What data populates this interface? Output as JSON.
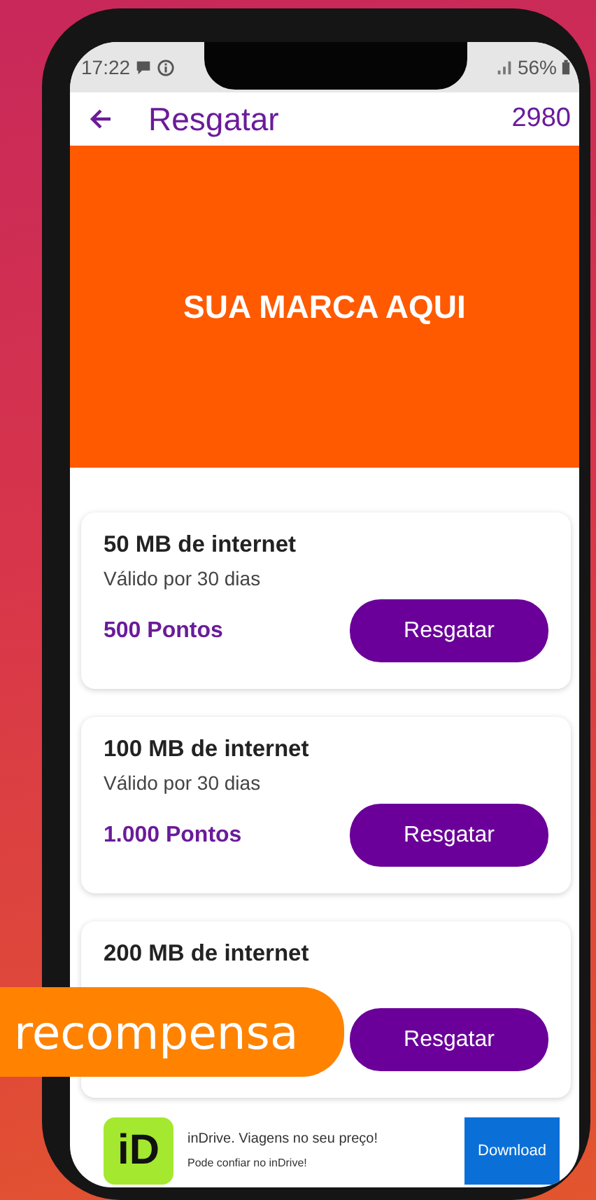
{
  "status_bar": {
    "time": "17:22",
    "battery": "56%"
  },
  "app_bar": {
    "title": "Resgatar",
    "points": "2980"
  },
  "banner": {
    "text": "SUA MARCA AQUI"
  },
  "rewards": [
    {
      "title": "50 MB de internet",
      "validity": "Válido por 30 dias",
      "points": "500 Pontos",
      "button": "Resgatar"
    },
    {
      "title": "100 MB de internet",
      "validity": "Válido por 30 dias",
      "points": "1.000 Pontos",
      "button": "Resgatar"
    },
    {
      "title": "200 MB de internet",
      "button": "Resgatar"
    }
  ],
  "ad": {
    "logo": "iD",
    "headline": "inDrive. Viagens no seu preço!",
    "tagline": "Pode confiar no inDrive!",
    "button": "Download"
  },
  "overlay_label": "recompensa"
}
